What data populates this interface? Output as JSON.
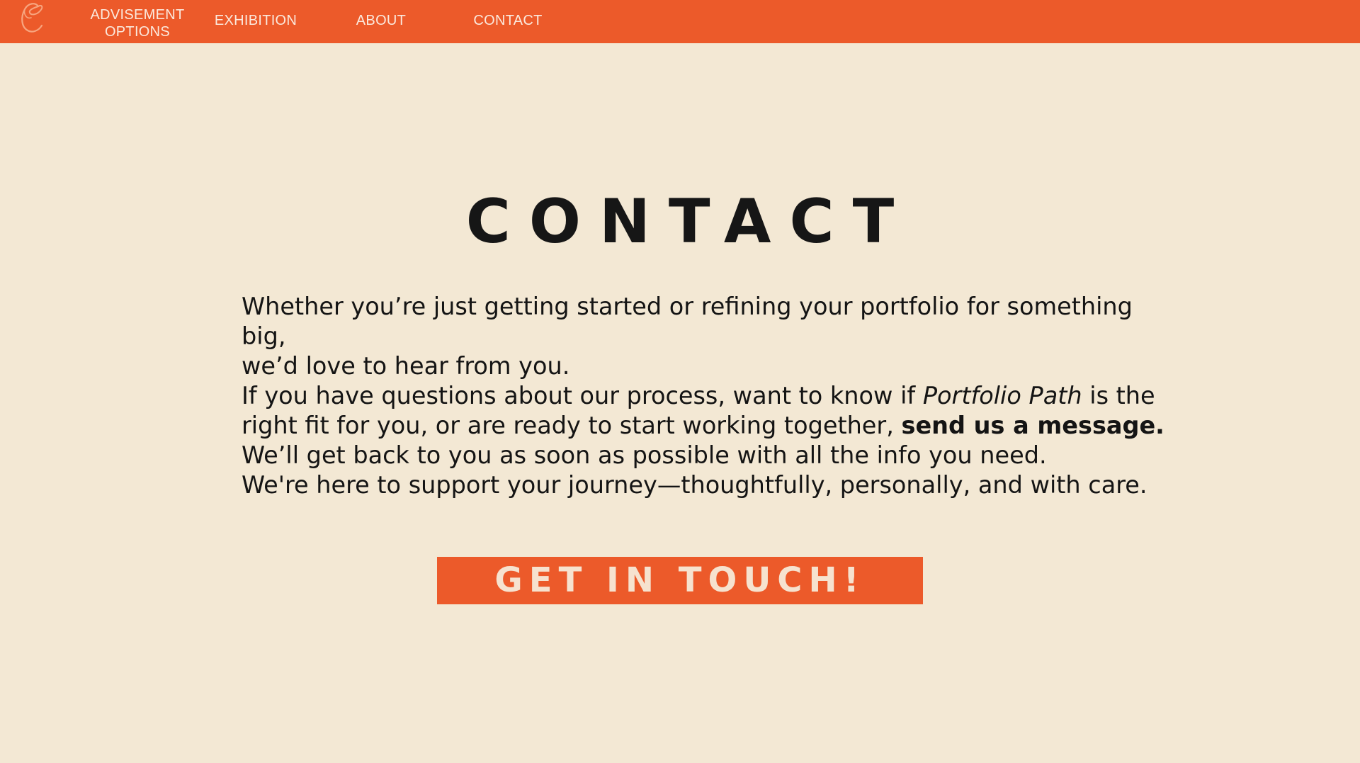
{
  "nav": {
    "logo_icon": "script-c-logo-icon",
    "items": [
      {
        "line1": "ADVISEMENT",
        "line2": "OPTIONS"
      },
      {
        "label": "EXHIBITION"
      },
      {
        "label": "ABOUT"
      },
      {
        "label": "CONTACT"
      }
    ]
  },
  "page": {
    "title": "CONTACT",
    "paragraph1_line1": "Whether you’re just getting started or refining your portfolio for something big,",
    "paragraph1_line2": "we’d love to hear from you.",
    "paragraph2_start": "If you have questions about our process, want to know if ",
    "paragraph2_italic": "Portfolio Path",
    "paragraph2_middle": " is the right fit for you, or are ready to start working together, ",
    "paragraph2_bold": "send us a message.",
    "paragraph3": "We’ll get back to you as soon as possible with all the info you need.",
    "paragraph4": "We're here to support your journey—thoughtfully, personally, and with care."
  },
  "cta": {
    "label": "GET IN TOUCH!"
  },
  "colors": {
    "accent": "#ec5a2a",
    "background": "#f3e8d4",
    "nav_text": "#fbe9dd",
    "text": "#141414"
  }
}
